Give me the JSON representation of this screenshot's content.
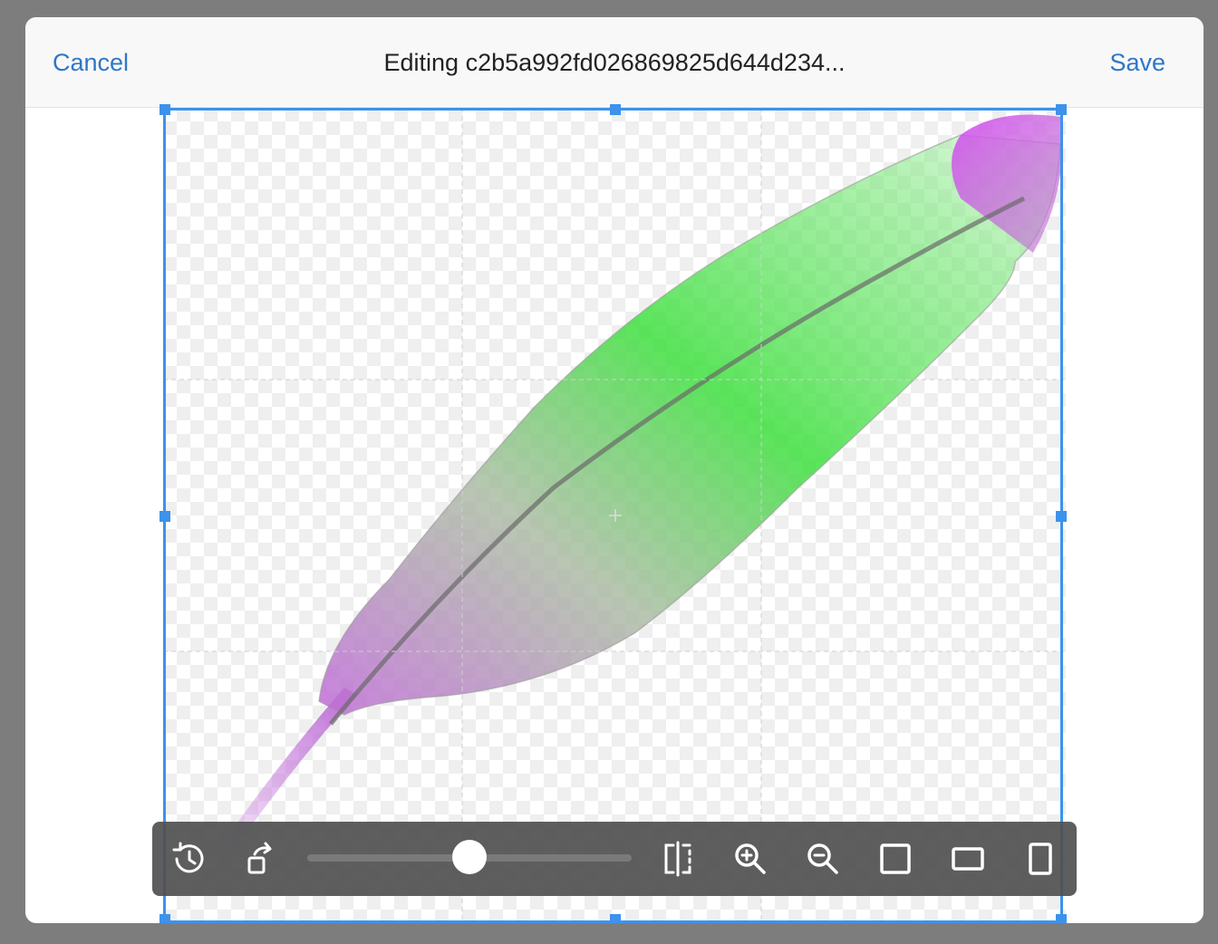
{
  "header": {
    "cancel_label": "Cancel",
    "title": "Editing c2b5a992fd026869825d644d234...",
    "save_label": "Save"
  },
  "toolbar": {
    "buttons": [
      {
        "icon": "reset-history-icon"
      },
      {
        "icon": "rotate-icon"
      },
      {
        "icon": "flip-horizontal-icon"
      },
      {
        "icon": "zoom-in-icon"
      },
      {
        "icon": "zoom-out-icon"
      },
      {
        "icon": "aspect-square-icon"
      },
      {
        "icon": "aspect-landscape-icon"
      },
      {
        "icon": "aspect-portrait-icon"
      }
    ],
    "slider_value": 0.5
  },
  "colors": {
    "accent": "#2e77c8",
    "crop_border": "#3d92ec",
    "toolbar_bg": "#505050"
  }
}
